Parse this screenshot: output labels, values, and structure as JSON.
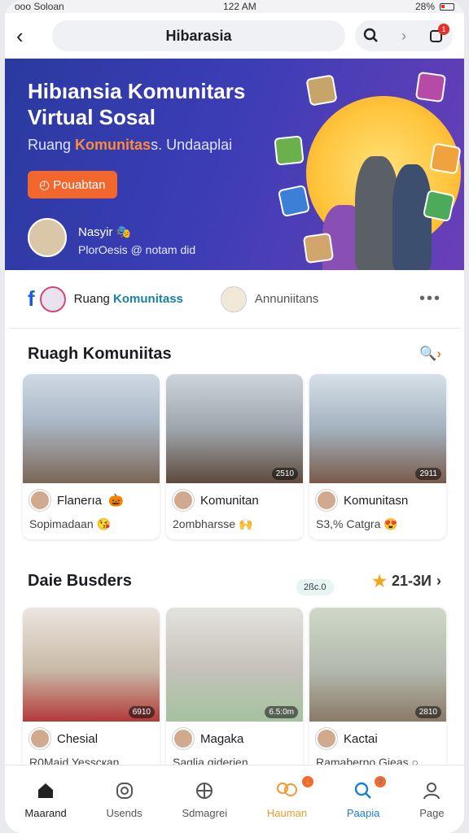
{
  "statusbar": {
    "carrier": "ooo Soloan",
    "time": "122 AM",
    "battery": "28%"
  },
  "topbar": {
    "title": "Hibarasia",
    "notif_count": "1"
  },
  "hero": {
    "title": "Hibıansia Komunitars Virtual Sosal",
    "subtitle_prefix": "Ruang ",
    "subtitle_accent": "Komunitas",
    "subtitle_suffix": "s. Undaaplai",
    "cta": "Pouabtan",
    "person_name": "Nasyir",
    "person_desc": "PlorOesis @ notam did"
  },
  "tabs": [
    {
      "label_prefix": "Ruang ",
      "label_accent": "Komunitass"
    },
    {
      "label": "Annuniitans"
    }
  ],
  "section1": {
    "title": "Ruagh Komuniitas",
    "cards": [
      {
        "name": "Flanerıa",
        "sub": "Sopimadaan",
        "dur": ""
      },
      {
        "name": "Komunitan",
        "sub": "2ombharsse",
        "dur": "2510"
      },
      {
        "name": "Komunitasn",
        "sub": "S3,% Catgra",
        "dur": "2911"
      }
    ]
  },
  "section2": {
    "title": "Daie Busders",
    "range": "21-3И",
    "bubble": "2ßc.0",
    "cards": [
      {
        "name": "Chesial",
        "sub": "R0Maid Yesscкan",
        "dur": "6910"
      },
      {
        "name": "Magaka",
        "sub": "Saglia giderien",
        "dur": "6.5:0m"
      },
      {
        "name": "Kactai",
        "sub": "Ramaberno Gieas",
        "dur": "2810"
      }
    ]
  },
  "nav": [
    {
      "label": "Maarand",
      "icon": "home-icon"
    },
    {
      "label": "Usends",
      "icon": "circle-icon"
    },
    {
      "label": "Sdmagrei",
      "icon": "globe-icon"
    },
    {
      "label": "Hauman",
      "icon": "community-icon",
      "badge": "1"
    },
    {
      "label": "Paapia",
      "icon": "search-icon",
      "badge": "7"
    },
    {
      "label": "Page",
      "icon": "user-icon"
    }
  ],
  "colors": {
    "accent": "#f2672e",
    "hero_start": "#2a3aa0",
    "hero_end": "#6a3fb8",
    "link_blue": "#1b7fa6"
  }
}
